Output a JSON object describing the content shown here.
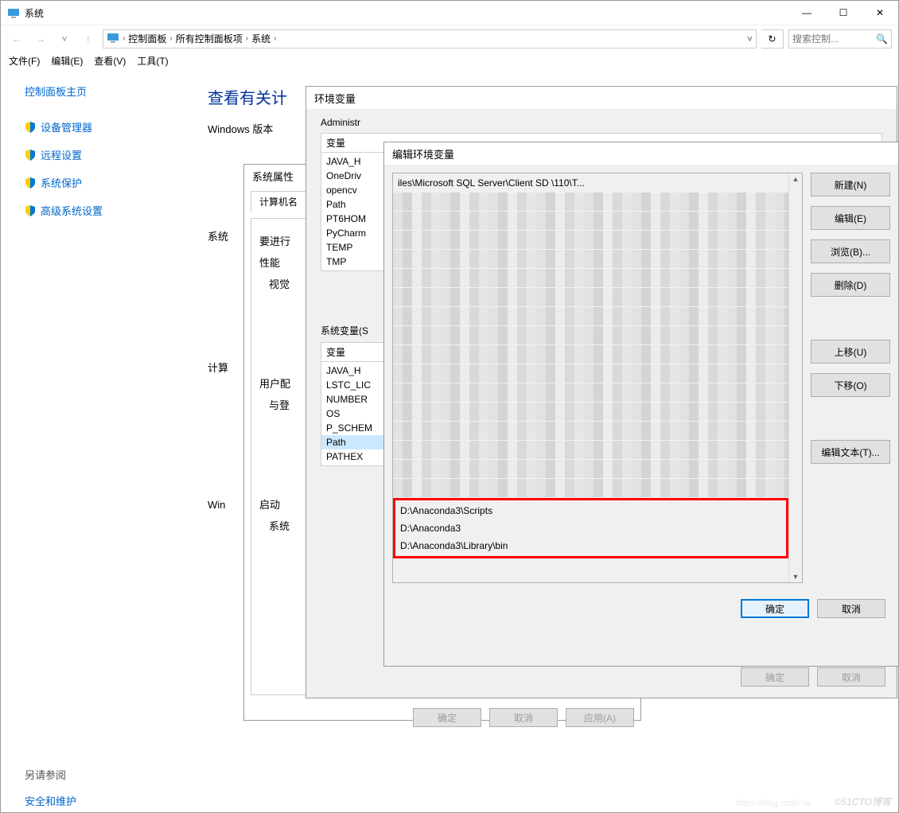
{
  "system_window": {
    "title": "系统",
    "nav": {
      "back": "←",
      "fwd": "→",
      "up": "↑"
    },
    "breadcrumbs": [
      "控制面板",
      "所有控制面板项",
      "系统"
    ],
    "search_placeholder": "搜索控制...",
    "menus": [
      "文件(F)",
      "编辑(E)",
      "查看(V)",
      "工具(T)"
    ],
    "sidebar": {
      "home": "控制面板主页",
      "links": [
        "设备管理器",
        "远程设置",
        "系统保护",
        "高级系统设置"
      ],
      "see_also_label": "另请参阅",
      "see_also_link": "安全和维护"
    },
    "main": {
      "heading": "查看有关计",
      "windows_line": "Windows 版本",
      "rows": [
        "系统",
        "计算",
        "Win"
      ]
    }
  },
  "sysprops": {
    "title": "系统属性",
    "tabs": [
      "计算机名"
    ],
    "labels": [
      "要进行",
      "性能",
      "视觉",
      "用户配",
      "与登",
      "启动",
      "系统"
    ],
    "buttons": {
      "ok": "确定",
      "cancel": "取消",
      "apply": "应用(A)"
    }
  },
  "env": {
    "title": "环境变量",
    "user_header": "Administr",
    "col_var": "变量",
    "user_vars": [
      "JAVA_H",
      "OneDriv",
      "opencv",
      "Path",
      "PT6HOM",
      "PyCharm",
      "TEMP",
      "TMP"
    ],
    "sys_header": "系统变量(S",
    "sys_vars": [
      "JAVA_H",
      "LSTC_LIC",
      "NUMBER",
      "OS",
      "P_SCHEM",
      "Path",
      "PATHEX"
    ],
    "sys_selected_index": 5,
    "buttons": {
      "ok": "确定",
      "cancel": "取消"
    }
  },
  "edit": {
    "title": "编辑环境变量",
    "path_items_top": "iles\\Microsoft SQL Server\\Client SD         \\110\\T...",
    "blur_rows": 16,
    "highlighted": [
      "D:\\Anaconda3\\Scripts",
      "D:\\Anaconda3",
      "D:\\Anaconda3\\Library\\bin"
    ],
    "side_buttons": {
      "new": "新建(N)",
      "edit": "编辑(E)",
      "browse": "浏览(B)...",
      "delete": "删除(D)",
      "up": "上移(U)",
      "down": "下移(O)",
      "edit_text": "编辑文本(T)..."
    },
    "buttons": {
      "ok": "确定",
      "cancel": "取消"
    }
  },
  "watermark": "©51CTO博客",
  "watermark2": "https://blog.csdn.ne"
}
